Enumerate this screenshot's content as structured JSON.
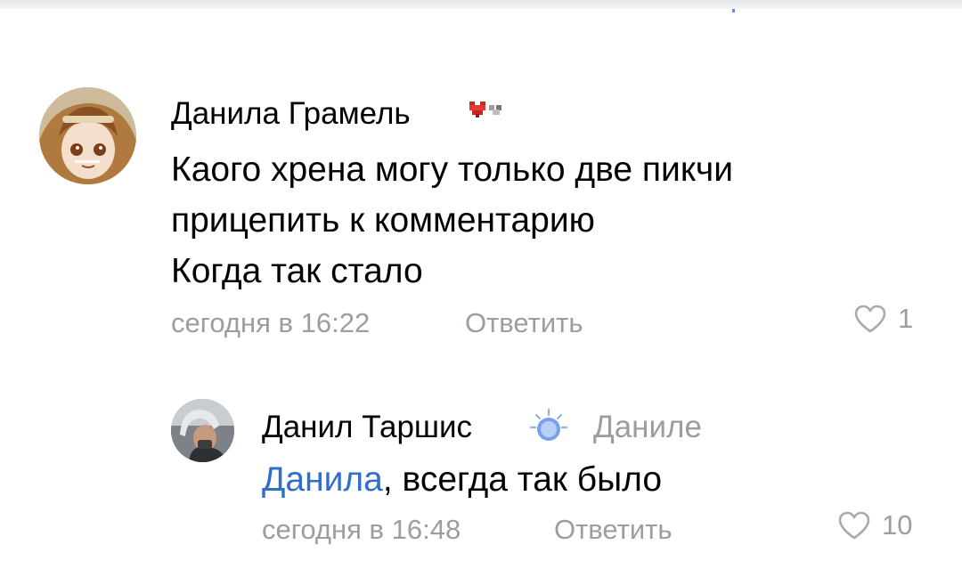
{
  "comments": [
    {
      "author": "Данила Грамель",
      "author_badge_icon": "pixel-heart-badge-icon",
      "text_lines": [
        "Каого хрена могу только две пикчи",
        "прицепить к комментарию",
        "Когда так стало"
      ],
      "time": "сегодня в 16:22",
      "reply_label": "Ответить",
      "likes": "1",
      "like_icon": "heart-outline-icon"
    }
  ],
  "replies": [
    {
      "author": "Данил Таршис",
      "author_badge_icon": "sparkle-sun-badge-icon",
      "addressee": "Даниле",
      "mention": "Данила",
      "text": ", всегда так было",
      "time": "сегодня в 16:48",
      "reply_label": "Ответить",
      "likes": "10",
      "like_icon": "heart-outline-icon"
    }
  ],
  "colors": {
    "text": "#000000",
    "meta": "#9a9da2",
    "mention": "#2f6fc9",
    "heart_outline": "#a7aab0"
  }
}
